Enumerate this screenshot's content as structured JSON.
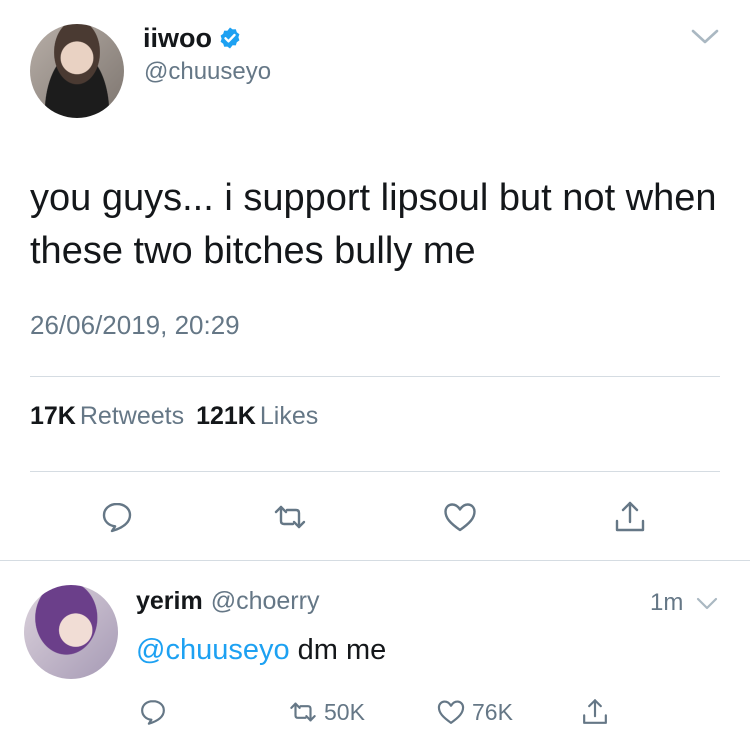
{
  "tweet": {
    "display_name": "iiwoo",
    "handle": "@chuuseyo",
    "verified": true,
    "text": "you guys... i support lipsoul but not when these two bitches bully me",
    "timestamp": "26/06/2019, 20:29",
    "retweets_count": "17K",
    "retweets_label": "Retweets",
    "likes_count": "121K",
    "likes_label": "Likes",
    "actions": [
      "reply-icon",
      "retweet-icon",
      "heart-icon",
      "share-icon"
    ]
  },
  "reply": {
    "display_name": "yerim",
    "handle": "@choerry",
    "time": "1m",
    "mention": "@chuuseyo",
    "text": " dm me",
    "retweets": "50K",
    "likes": "76K"
  },
  "colors": {
    "accent": "#1da1f2",
    "muted": "#657786",
    "text": "#14171a",
    "divider": "#d5dce2"
  }
}
